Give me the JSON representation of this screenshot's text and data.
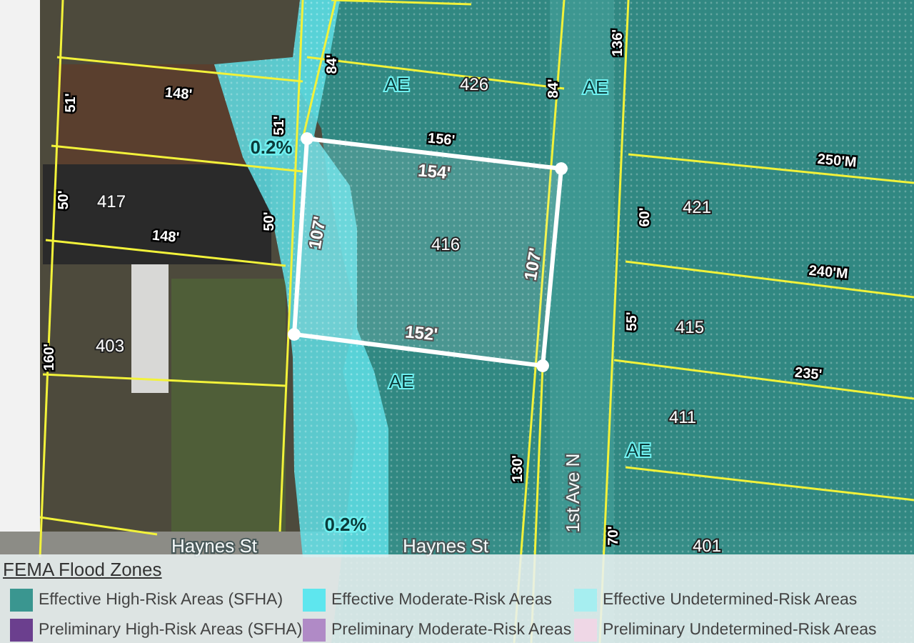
{
  "map": {
    "labels": [
      {
        "kind": "dimension",
        "text": "148'"
      },
      {
        "kind": "dimension",
        "text": "51'"
      },
      {
        "kind": "dimension",
        "text": "84'"
      },
      {
        "kind": "zone",
        "text": "AE"
      },
      {
        "kind": "lot",
        "text": "426"
      },
      {
        "kind": "dimension",
        "text": "84'"
      },
      {
        "kind": "zone",
        "text": "AE"
      },
      {
        "kind": "dimension",
        "text": "136'"
      },
      {
        "kind": "dimension",
        "text": "51'"
      },
      {
        "kind": "percent",
        "text": "0.2%"
      },
      {
        "kind": "dimension",
        "text": "156'"
      },
      {
        "kind": "subject",
        "text": "154'"
      },
      {
        "kind": "dimension",
        "text": "250'M"
      },
      {
        "kind": "dimension",
        "text": "50'"
      },
      {
        "kind": "lot",
        "text": "417"
      },
      {
        "kind": "dimension",
        "text": "148'"
      },
      {
        "kind": "dimension",
        "text": "50'"
      },
      {
        "kind": "subject",
        "text": "107'"
      },
      {
        "kind": "lot",
        "text": "416"
      },
      {
        "kind": "subject",
        "text": "107'"
      },
      {
        "kind": "lot",
        "text": "421"
      },
      {
        "kind": "dimension",
        "text": "60'"
      },
      {
        "kind": "dimension",
        "text": "240'M"
      },
      {
        "kind": "dimension",
        "text": "160'"
      },
      {
        "kind": "lot",
        "text": "403"
      },
      {
        "kind": "subject",
        "text": "152'"
      },
      {
        "kind": "dimension",
        "text": "55'"
      },
      {
        "kind": "lot",
        "text": "415"
      },
      {
        "kind": "zone",
        "text": "AE"
      },
      {
        "kind": "dimension",
        "text": "235'"
      },
      {
        "kind": "lot",
        "text": "411"
      },
      {
        "kind": "dimension",
        "text": "130'"
      },
      {
        "kind": "street",
        "text": "1st Ave N"
      },
      {
        "kind": "zone",
        "text": "AE"
      },
      {
        "kind": "percent",
        "text": "0.2%"
      },
      {
        "kind": "dimension",
        "text": "70'"
      },
      {
        "kind": "street",
        "text": "Haynes St"
      },
      {
        "kind": "street",
        "text": "Haynes St"
      },
      {
        "kind": "lot",
        "text": "401"
      }
    ]
  },
  "legend": {
    "title": "FEMA Flood Zones",
    "items": [
      {
        "label": "Effective High-Risk Areas (SFHA)",
        "color": "#3a9690"
      },
      {
        "label": "Effective Moderate-Risk Areas",
        "color": "#5ee6ee"
      },
      {
        "label": "Effective Undetermined-Risk Areas",
        "color": "#a6eef0"
      },
      {
        "label": "Preliminary High-Risk Areas (SFHA)",
        "color": "#6b3f8e"
      },
      {
        "label": "Preliminary Moderate-Risk Areas",
        "color": "#b08ac6"
      },
      {
        "label": "Preliminary Undetermined-Risk Areas",
        "color": "#efd7e6"
      }
    ]
  }
}
